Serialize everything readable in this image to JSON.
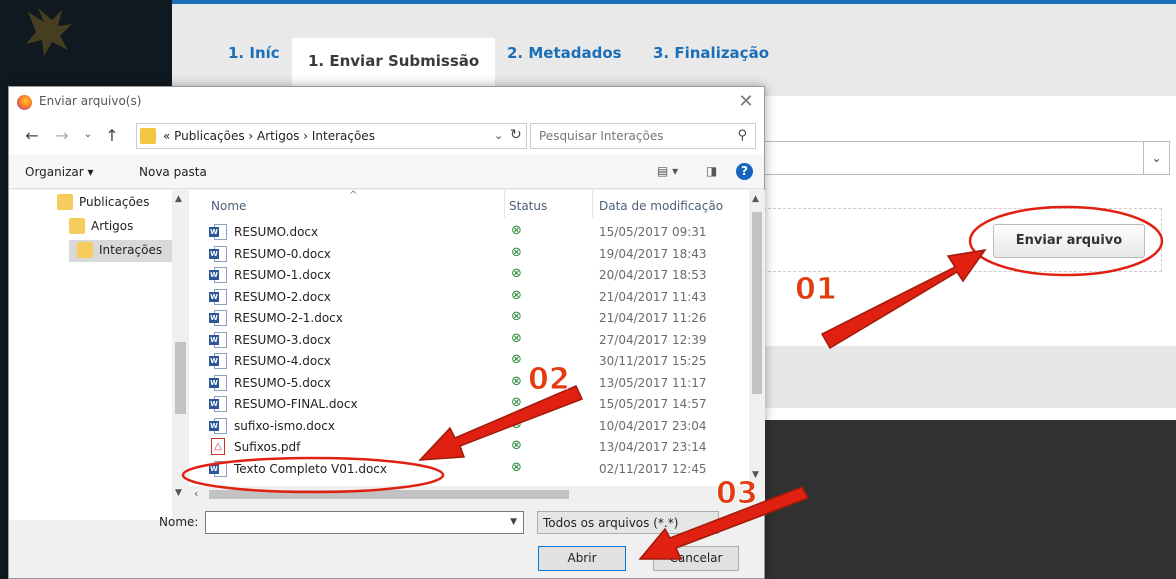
{
  "background_page": {
    "tabs": [
      {
        "label": "1. Iníc"
      },
      {
        "label": "1. Enviar Submissão"
      },
      {
        "label": "2. Metadados"
      },
      {
        "label": "3. Finalização"
      }
    ],
    "upload_button": "Enviar arquivo"
  },
  "dialog": {
    "title": "Enviar arquivo(s)",
    "address": "« Publicações  ›  Artigos  ›  Interações",
    "search_placeholder": "Pesquisar Interações",
    "toolbar": {
      "organize": "Organizar ▾",
      "new_folder": "Nova pasta"
    },
    "tree": [
      {
        "label": "Publicações"
      },
      {
        "label": "Artigos"
      },
      {
        "label": "Interações"
      }
    ],
    "columns": {
      "name": "Nome",
      "status": "Status",
      "modified": "Data de modificação"
    },
    "files": [
      {
        "name": "RESUMO.docx",
        "date": "15/05/2017 09:31",
        "type": "word"
      },
      {
        "name": "RESUMO-0.docx",
        "date": "19/04/2017 18:43",
        "type": "word"
      },
      {
        "name": "RESUMO-1.docx",
        "date": "20/04/2017 18:53",
        "type": "word"
      },
      {
        "name": "RESUMO-2.docx",
        "date": "21/04/2017 11:43",
        "type": "word"
      },
      {
        "name": "RESUMO-2-1.docx",
        "date": "21/04/2017 11:26",
        "type": "word"
      },
      {
        "name": "RESUMO-3.docx",
        "date": "27/04/2017 12:39",
        "type": "word"
      },
      {
        "name": "RESUMO-4.docx",
        "date": "30/11/2017 15:25",
        "type": "word"
      },
      {
        "name": "RESUMO-5.docx",
        "date": "13/05/2017 11:17",
        "type": "word"
      },
      {
        "name": "RESUMO-FINAL.docx",
        "date": "15/05/2017 14:57",
        "type": "word"
      },
      {
        "name": "sufixo-ismo.docx",
        "date": "10/04/2017 23:04",
        "type": "word"
      },
      {
        "name": "Sufixos.pdf",
        "date": "13/04/2017 23:14",
        "type": "pdf"
      },
      {
        "name": "Texto Completo V01.docx",
        "date": "02/11/2017 12:45",
        "type": "word"
      }
    ],
    "name_label": "Nome:",
    "name_value": "",
    "filter": "Todos os arquivos (*.*)",
    "open_button": "Abrir",
    "cancel_button": "Cancelar"
  },
  "annotations": [
    "01",
    "02",
    "03"
  ],
  "colors": {
    "accent": "#1b6fb8",
    "annotation": "#e02010",
    "status_ok": "#2e8b3c"
  }
}
